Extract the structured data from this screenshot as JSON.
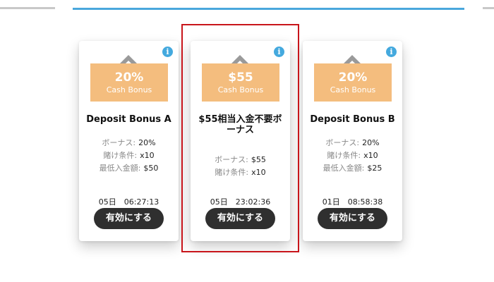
{
  "cards": [
    {
      "badge_value": "20%",
      "badge_label": "Cash Bonus",
      "title": "Deposit Bonus A",
      "details": [
        {
          "label": "ボーナス:",
          "value": "20%"
        },
        {
          "label": "賭け条件:",
          "value": "x10"
        },
        {
          "label": "最低入金額:",
          "value": "$50"
        }
      ],
      "timer": "05日　06:27:13",
      "button": "有効にする",
      "info": "i"
    },
    {
      "badge_value": "$55",
      "badge_label": "Cash Bonus",
      "title": "$55相当入金不要ボーナス",
      "details": [
        {
          "label": "ボーナス:",
          "value": "$55"
        },
        {
          "label": "賭け条件:",
          "value": "x10"
        }
      ],
      "timer": "05日　23:02:36",
      "button": "有効にする",
      "info": "i"
    },
    {
      "badge_value": "20%",
      "badge_label": "Cash Bonus",
      "title": "Deposit Bonus B",
      "details": [
        {
          "label": "ボーナス:",
          "value": "20%"
        },
        {
          "label": "賭け条件:",
          "value": "x10"
        },
        {
          "label": "最低入金額:",
          "value": "$25"
        }
      ],
      "timer": "01日　08:58:38",
      "button": "有効にする",
      "info": "i"
    }
  ],
  "colors": {
    "accent_blue": "#4aa7dc",
    "badge_orange": "#f4bd7e",
    "button_dark": "#2f2f2f",
    "highlight_red": "#c8151b"
  }
}
